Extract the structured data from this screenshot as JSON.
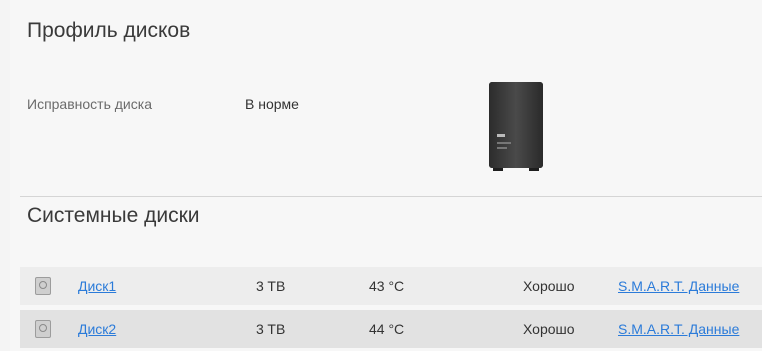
{
  "profile": {
    "title": "Профиль дисков",
    "health_label": "Исправность диска",
    "health_value": "В норме"
  },
  "system_disks": {
    "title": "Системные диски",
    "rows": [
      {
        "name": "Диск1",
        "size": "3 TB",
        "temp": "43 °C",
        "status": "Хорошо",
        "smart_link": "S.M.A.R.T. Данные",
        "icon": "disk-icon"
      },
      {
        "name": "Диск2",
        "size": "3 TB",
        "temp": "44 °C",
        "status": "Хорошо",
        "smart_link": "S.M.A.R.T. Данные",
        "icon": "disk-icon"
      }
    ]
  },
  "colors": {
    "link": "#2b7bd9",
    "row_odd": "#ededed",
    "row_even": "#e2e2e2"
  }
}
